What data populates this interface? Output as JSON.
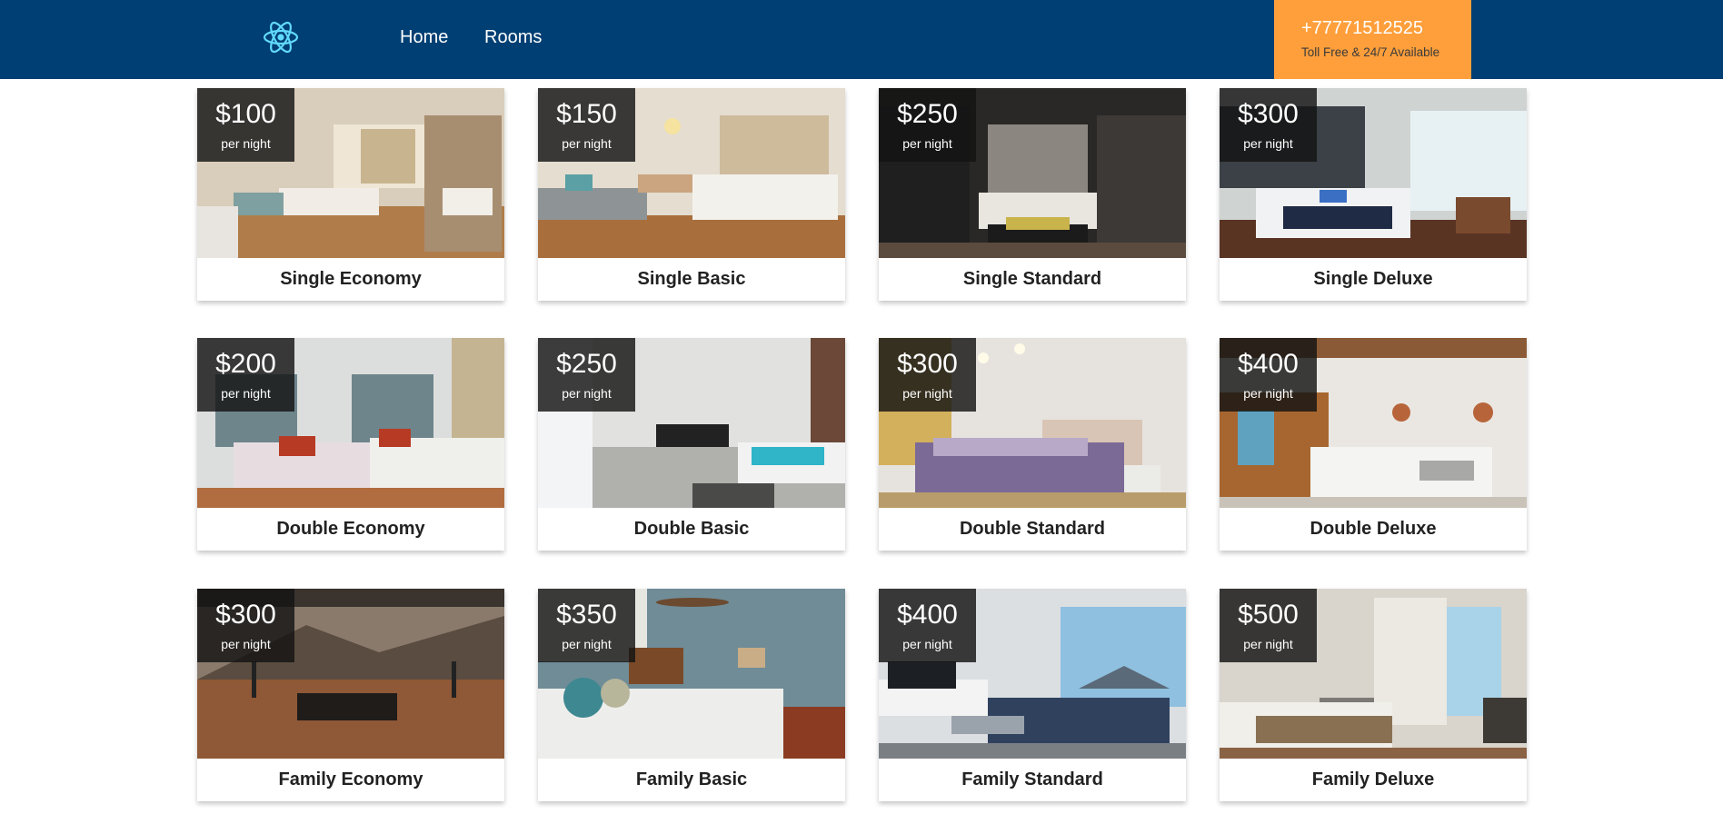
{
  "nav": {
    "logo_icon": "atom-icon",
    "links": [
      {
        "label": "Home"
      },
      {
        "label": "Rooms"
      }
    ]
  },
  "contact": {
    "phone": "+77771512525",
    "subtitle": "Toll Free & 24/7 Available"
  },
  "colors": {
    "navbar": "#003f73",
    "accent": "#ff9f3b",
    "logo": "#61dafb"
  },
  "rooms": [
    {
      "price": "$100",
      "unit": "per night",
      "name": "Single Economy"
    },
    {
      "price": "$150",
      "unit": "per night",
      "name": "Single Basic"
    },
    {
      "price": "$250",
      "unit": "per night",
      "name": "Single Standard"
    },
    {
      "price": "$300",
      "unit": "per night",
      "name": "Single Deluxe"
    },
    {
      "price": "$200",
      "unit": "per night",
      "name": "Double Economy"
    },
    {
      "price": "$250",
      "unit": "per night",
      "name": "Double Basic"
    },
    {
      "price": "$300",
      "unit": "per night",
      "name": "Double Standard"
    },
    {
      "price": "$400",
      "unit": "per night",
      "name": "Double Deluxe"
    },
    {
      "price": "$300",
      "unit": "per night",
      "name": "Family Economy"
    },
    {
      "price": "$350",
      "unit": "per night",
      "name": "Family Basic"
    },
    {
      "price": "$400",
      "unit": "per night",
      "name": "Family Standard"
    },
    {
      "price": "$500",
      "unit": "per night",
      "name": "Family Deluxe"
    }
  ]
}
